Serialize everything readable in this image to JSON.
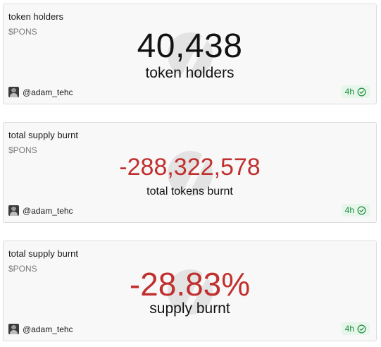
{
  "cards": [
    {
      "title": "token holders",
      "subtitle": "$PONS",
      "value": "40,438",
      "label": "token holders",
      "author": "@adam_tehc",
      "age": "4h"
    },
    {
      "title": "total supply burnt",
      "subtitle": "$PONS",
      "value": "-288,322,578",
      "label": "total tokens burnt",
      "author": "@adam_tehc",
      "age": "4h"
    },
    {
      "title": "total supply burnt",
      "subtitle": "$PONS",
      "value": "-28.83%",
      "label": "supply burnt",
      "author": "@adam_tehc",
      "age": "4h"
    }
  ],
  "colors": {
    "negative_value": "#c0302e",
    "status_green": "#1d8a3e",
    "card_background": "#f8f8f8"
  },
  "icons": {
    "watermark": "watermark-logo-icon",
    "status": "check-circle-icon",
    "avatar": "user-avatar"
  }
}
